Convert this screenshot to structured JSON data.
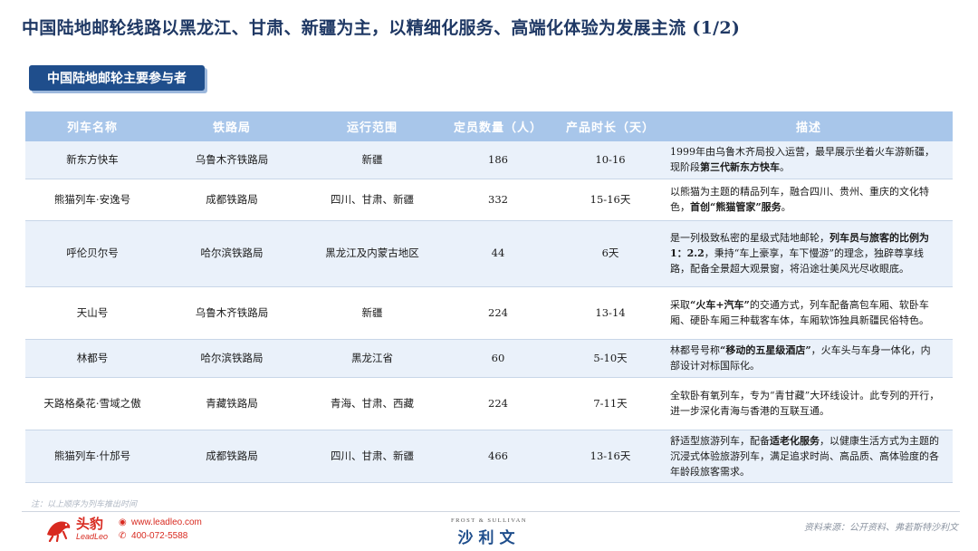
{
  "page": {
    "title": "中国陆地邮轮线路以黑龙江、甘肃、新疆为主，以精细化服务、高端化体验为发展主流 (1/2)",
    "section_tag": "中国陆地邮轮主要参与者"
  },
  "table": {
    "headers": [
      "列车名称",
      "铁路局",
      "运行范围",
      "定员数量（人）",
      "产品时长（天）",
      "描述"
    ],
    "rows": [
      {
        "name": "新东方快车",
        "bureau": "乌鲁木齐铁路局",
        "range": "新疆",
        "capacity": "186",
        "duration": "10-16",
        "desc": [
          {
            "t": "1999年由乌鲁木齐局投入运营，最早展示坐着火车游新疆，现阶段",
            "b": false
          },
          {
            "t": "第三代新东方快车",
            "b": true
          },
          {
            "t": "。",
            "b": false
          }
        ]
      },
      {
        "name": "熊猫列车·安逸号",
        "bureau": "成都铁路局",
        "range": "四川、甘肃、新疆",
        "capacity": "332",
        "duration": "15-16天",
        "desc": [
          {
            "t": "以熊猫为主题的精品列车，融合四川、贵州、重庆的文化特色，",
            "b": false
          },
          {
            "t": "首创“熊猫管家”服务",
            "b": true
          },
          {
            "t": "。",
            "b": false
          }
        ]
      },
      {
        "name": "呼伦贝尔号",
        "bureau": "哈尔滨铁路局",
        "range": "黑龙江及内蒙古地区",
        "capacity": "44",
        "duration": "6天",
        "desc": [
          {
            "t": "是一列极致私密的星级式陆地邮轮，",
            "b": false
          },
          {
            "t": "列车员与旅客的比例为1：2.2",
            "b": true
          },
          {
            "t": "，秉持“车上豪享，车下慢游”的理念，独辟尊享线路，配备全景超大观景窗，将沿途壮美风光尽收眼底。",
            "b": false
          }
        ]
      },
      {
        "name": "天山号",
        "bureau": "乌鲁木齐铁路局",
        "range": "新疆",
        "capacity": "224",
        "duration": "13-14",
        "desc": [
          {
            "t": "采取",
            "b": false
          },
          {
            "t": "“火车+汽车”",
            "b": true
          },
          {
            "t": "的交通方式，列车配备高包车厢、软卧车厢、硬卧车厢三种载客车体，车厢软饰独具新疆民俗特色。",
            "b": false
          }
        ]
      },
      {
        "name": "林都号",
        "bureau": "哈尔滨铁路局",
        "range": "黑龙江省",
        "capacity": "60",
        "duration": "5-10天",
        "desc": [
          {
            "t": "林都号号称",
            "b": false
          },
          {
            "t": "“移动的五星级酒店”",
            "b": true
          },
          {
            "t": "，火车头与车身一体化，内部设计对标国际化。",
            "b": false
          }
        ]
      },
      {
        "name": "天路格桑花·雪域之傲",
        "bureau": "青藏铁路局",
        "range": "青海、甘肃、西藏",
        "capacity": "224",
        "duration": "7-11天",
        "desc": [
          {
            "t": "全软卧有氧列车，专为“青甘藏”大环线设计。此专列的开行，进一步深化青海与香港的互联互通。",
            "b": false
          }
        ]
      },
      {
        "name": "熊猫列车·什邡号",
        "bureau": "成都铁路局",
        "range": "四川、甘肃、新疆",
        "capacity": "466",
        "duration": "13-16天",
        "desc": [
          {
            "t": "舒适型旅游列车，配备",
            "b": false
          },
          {
            "t": "适老化服务",
            "b": true
          },
          {
            "t": "，以健康生活方式为主题的沉浸式体验旅游列车，满足追求时尚、高品质、高体验度的各年龄段旅客需求。",
            "b": false
          }
        ]
      }
    ]
  },
  "footer": {
    "note": "注：以上顺序为列车推出时间",
    "logo_cn": "头豹",
    "logo_en": "LeadLeo",
    "website": "www.leadleo.com",
    "phone": "400-072-5588",
    "partner_en": "FROST & SULLIVAN",
    "partner_cn": "沙利文",
    "source": "资料来源：公开资料、弗若斯特沙利文",
    "colors": {
      "brand_red": "#d82a20",
      "navy": "#1f3864",
      "header_blue": "#a8c6ea"
    }
  }
}
